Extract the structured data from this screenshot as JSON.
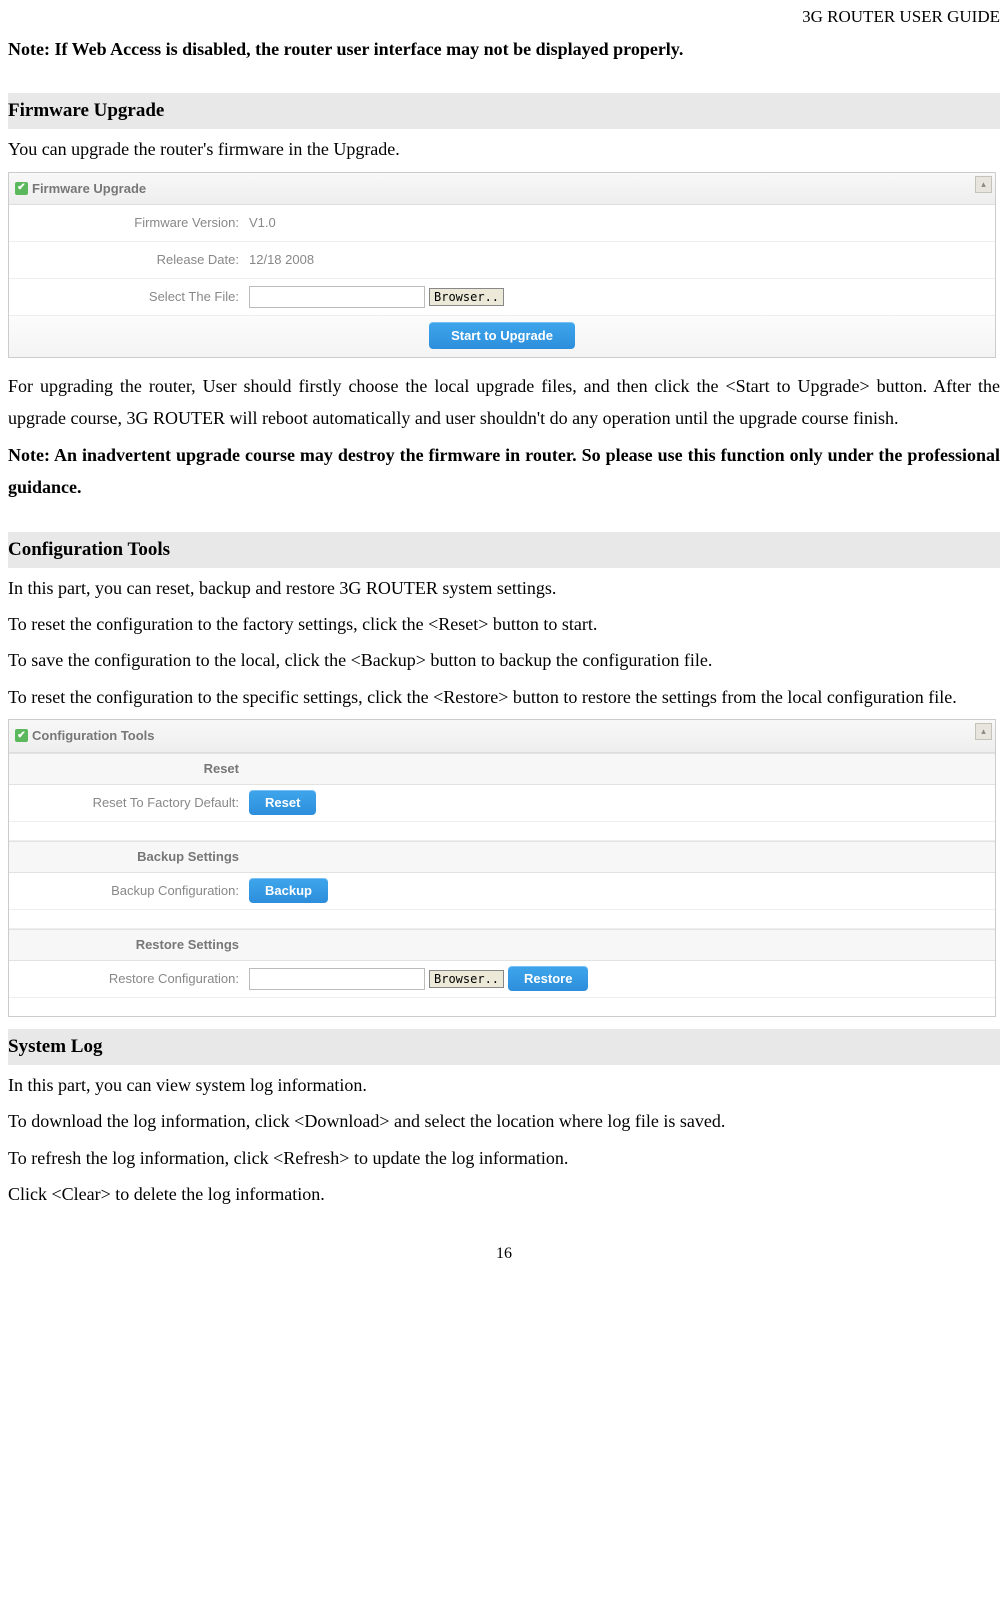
{
  "header": {
    "right": "3G ROUTER USER GUIDE"
  },
  "note_top": "Note: If Web Access is disabled, the router user interface may not be displayed properly.",
  "firmware": {
    "heading": "Firmware Upgrade",
    "intro": "You can upgrade the router's firmware in the Upgrade.",
    "panel_title": "Firmware Upgrade",
    "rows": {
      "version_label": "Firmware Version:",
      "version_value": "V1.0",
      "date_label": "Release Date:",
      "date_value": "12/18 2008",
      "file_label": "Select The File:",
      "file_value": "",
      "browse_label": "Browser..",
      "upgrade_btn": "Start to Upgrade"
    },
    "para": "For upgrading the router, User should firstly choose the local upgrade files, and then click the <Start to Upgrade> button. After the upgrade course, 3G ROUTER will reboot automatically and user shouldn't do any operation until the upgrade course finish.",
    "warn": "Note: An inadvertent upgrade course may destroy the firmware in router. So please use this function only under the professional guidance."
  },
  "config": {
    "heading": "Configuration Tools",
    "p1": "In this part, you can reset, backup and restore 3G ROUTER system settings.",
    "p2": "To reset the configuration to the factory settings, click the <Reset> button to start.",
    "p3": "To save the configuration to the local, click the <Backup> button to backup the configuration file.",
    "p4": "To reset the configuration to the specific settings, click the <Restore> button to restore the settings from the local configuration file.",
    "panel_title": "Configuration Tools",
    "reset_heading": "Reset",
    "reset_label": "Reset To Factory Default:",
    "reset_btn": "Reset",
    "backup_heading": "Backup Settings",
    "backup_label": "Backup Configuration:",
    "backup_btn": "Backup",
    "restore_heading": "Restore Settings",
    "restore_label": "Restore Configuration:",
    "restore_file_value": "",
    "browse_label": "Browser..",
    "restore_btn": "Restore"
  },
  "syslog": {
    "heading": "System Log",
    "p1": "In this part, you can view system log information.",
    "p2": "To download the log information, click <Download> and select the location where log file is saved.",
    "p3": "To refresh the log information, click <Refresh> to update the log information.",
    "p4": "Click <Clear> to delete the log information."
  },
  "page_number": "16"
}
